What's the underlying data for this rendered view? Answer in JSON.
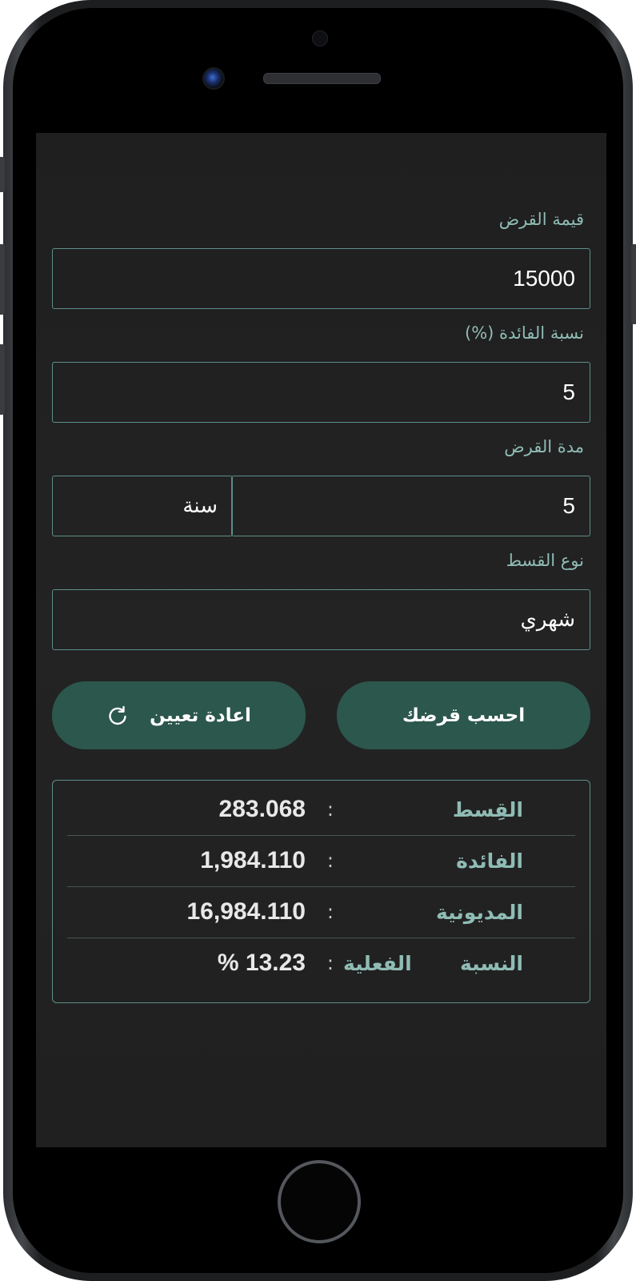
{
  "form": {
    "loan_amount": {
      "label": "قيمة القرض",
      "value": "15000"
    },
    "interest_rate": {
      "label": "نسبة الفائدة (%)",
      "value": "5"
    },
    "loan_term": {
      "label": "مدة القرض",
      "value": "5",
      "unit": "سنة"
    },
    "installment_type": {
      "label": "نوع القسط",
      "value": "شهري"
    }
  },
  "buttons": {
    "calculate_label": "احسب قرضك",
    "reset_label": "اعادة تعيين",
    "reset_icon": "refresh-icon"
  },
  "results": {
    "separator": ":",
    "rows": [
      {
        "label": "القِسط",
        "value": "283.068"
      },
      {
        "label": "الفائدة",
        "value": "1,984.110"
      },
      {
        "label": "المديونية",
        "value": "16,984.110"
      },
      {
        "label": "النسبة الفعلية",
        "value": "% 13.23"
      }
    ]
  },
  "colors": {
    "accent": "#2c574c",
    "label": "#8fbcb5",
    "border": "#5f8f89",
    "background": "#222222"
  }
}
